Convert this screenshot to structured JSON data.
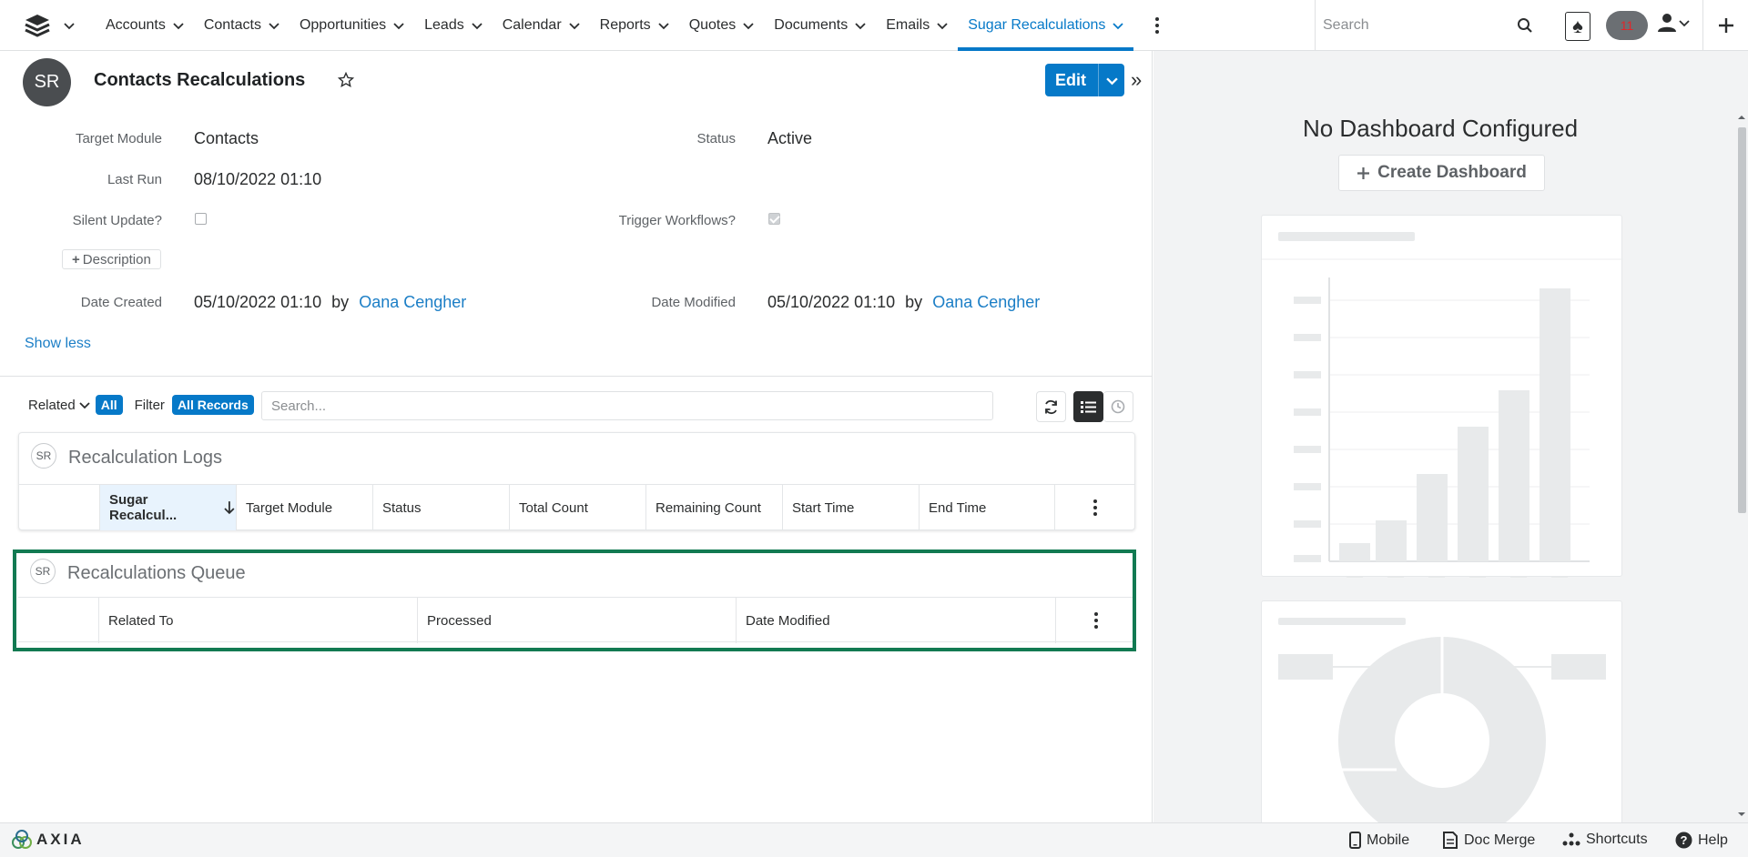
{
  "nav": {
    "tabs": [
      {
        "label": "Accounts"
      },
      {
        "label": "Contacts"
      },
      {
        "label": "Opportunities"
      },
      {
        "label": "Leads"
      },
      {
        "label": "Calendar"
      },
      {
        "label": "Reports"
      },
      {
        "label": "Quotes"
      },
      {
        "label": "Documents"
      },
      {
        "label": "Emails"
      },
      {
        "label": "Sugar Recalculations"
      }
    ],
    "search_placeholder": "Search",
    "notification_count": "11"
  },
  "record": {
    "avatar_initials": "SR",
    "title": "Contacts Recalculations",
    "edit_label": "Edit",
    "fields": {
      "target_module_label": "Target Module",
      "target_module_value": "Contacts",
      "status_label": "Status",
      "status_value": "Active",
      "last_run_label": "Last Run",
      "last_run_value": "08/10/2022 01:10",
      "silent_update_label": "Silent Update?",
      "silent_update_checked": false,
      "trigger_workflows_label": "Trigger Workflows?",
      "trigger_workflows_checked": true,
      "description_button": "Description",
      "date_created_label": "Date Created",
      "date_created_value": "05/10/2022 01:10",
      "date_created_by": "by",
      "date_created_user": "Oana Cengher",
      "date_modified_label": "Date Modified",
      "date_modified_value": "05/10/2022 01:10",
      "date_modified_by": "by",
      "date_modified_user": "Oana Cengher"
    },
    "show_less": "Show less"
  },
  "related": {
    "related_label": "Related",
    "related_pill": "All",
    "filter_label": "Filter",
    "filter_pill": "All Records",
    "search_placeholder": "Search..."
  },
  "subpanels": {
    "logs": {
      "avatar": "SR",
      "title": "Recalculation Logs",
      "columns": [
        "Sugar Recalcul...",
        "Target Module",
        "Status",
        "Total Count",
        "Remaining Count",
        "Start Time",
        "End Time"
      ]
    },
    "queue": {
      "avatar": "SR",
      "title": "Recalculations Queue",
      "columns": [
        "Related To",
        "Processed",
        "Date Modified"
      ]
    }
  },
  "dashboard": {
    "title": "No Dashboard Configured",
    "create_label": "Create Dashboard"
  },
  "footer": {
    "brand": "AXIA",
    "mobile": "Mobile",
    "doc_merge": "Doc Merge",
    "shortcuts": "Shortcuts",
    "help": "Help"
  },
  "colors": {
    "accent": "#0679c8",
    "highlight_border": "#127a52",
    "dashboard_bg": "#f2f3f4"
  }
}
